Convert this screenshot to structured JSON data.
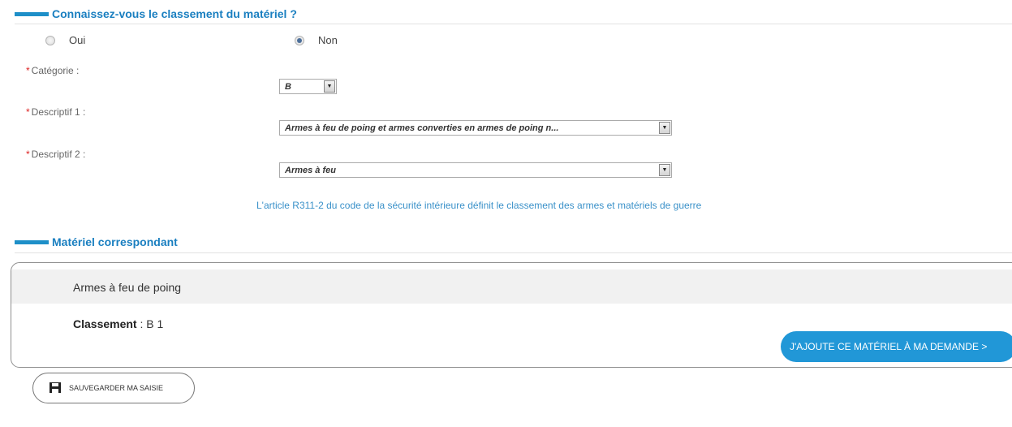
{
  "section1": {
    "title": "Connaissez-vous le classement du matériel ?"
  },
  "radio": {
    "oui_label": "Oui",
    "non_label": "Non",
    "selected": "Non"
  },
  "fields": {
    "categorie": {
      "required_mark": "*",
      "label": "Catégorie :",
      "value": "B"
    },
    "descriptif1": {
      "required_mark": "*",
      "label": "Descriptif 1 :",
      "value": "Armes à feu de poing et armes converties en armes de poing n..."
    },
    "descriptif2": {
      "required_mark": "*",
      "label": "Descriptif 2 :",
      "value": "Armes à feu"
    }
  },
  "info_link": "L'article R311-2 du code de la sécurité intérieure définit le classement des armes et matériels de guerre",
  "section2": {
    "title": "Matériel correspondant"
  },
  "material": {
    "name": "Armes à feu de poing",
    "classement_label": "Classement",
    "classement_sep": " : ",
    "classement_value": "B 1",
    "add_button": "J'AJOUTE CE MATÉRIEL À MA DEMANDE >"
  },
  "save_button": {
    "label": "SAUVEGARDER MA SAISIE",
    "icon": "save-icon"
  },
  "colors": {
    "accent": "#1e8fc8",
    "button_blue": "#2197d7",
    "required": "#dd2222"
  }
}
